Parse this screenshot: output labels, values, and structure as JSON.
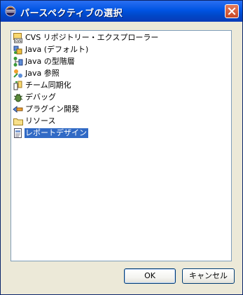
{
  "window": {
    "title": "パースペクティブの選択",
    "icon": "eclipse-icon",
    "close_icon": "close-icon"
  },
  "perspectives": [
    {
      "label": "CVS リポジトリー・エクスプローラー",
      "icon": "cvs-repository-icon",
      "selected": false
    },
    {
      "label": "Java (デフォルト)",
      "icon": "java-perspective-icon",
      "selected": false
    },
    {
      "label": "Java の型階層",
      "icon": "java-type-hierarchy-icon",
      "selected": false
    },
    {
      "label": "Java 参照",
      "icon": "java-browsing-icon",
      "selected": false
    },
    {
      "label": "チーム同期化",
      "icon": "team-synchronize-icon",
      "selected": false
    },
    {
      "label": "デバッグ",
      "icon": "debug-icon",
      "selected": false
    },
    {
      "label": "プラグイン開発",
      "icon": "plugin-development-icon",
      "selected": false
    },
    {
      "label": "リソース",
      "icon": "resource-folder-icon",
      "selected": false
    },
    {
      "label": "レポートデザイン",
      "icon": "report-design-icon",
      "selected": true
    }
  ],
  "buttons": {
    "ok": "OK",
    "cancel": "キャンセル"
  },
  "colors": {
    "titlebar": "#0054e3",
    "selection": "#316ac5",
    "dialog_bg": "#ece9d8"
  }
}
